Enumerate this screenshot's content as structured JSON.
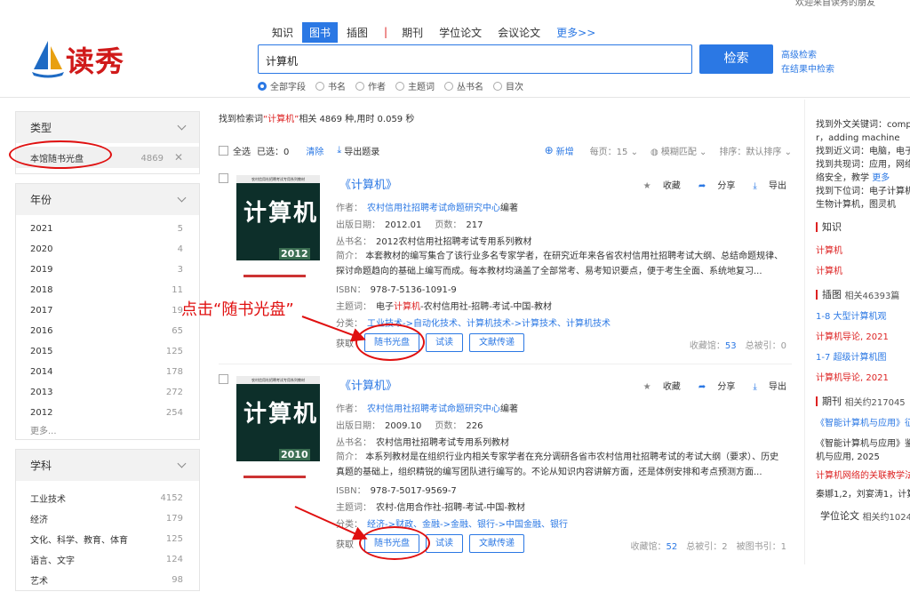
{
  "header": {
    "top_right_text": "欢迎来自读秀的朋友",
    "logo_text": "读秀",
    "tabs": [
      {
        "label": "知识",
        "active": false
      },
      {
        "label": "图书",
        "active": true
      },
      {
        "label": "插图",
        "active": false
      },
      {
        "label": "期刊",
        "active": false
      },
      {
        "label": "学位论文",
        "active": false
      },
      {
        "label": "会议论文",
        "active": false
      }
    ],
    "more_tabs": "更多>>",
    "search_value": "计算机",
    "search_button": "检索",
    "advanced_search": "高级检索",
    "search_in_results": "在结果中检索",
    "field_options": [
      "全部字段",
      "书名",
      "作者",
      "主题词",
      "丛书名",
      "目次"
    ],
    "selected_field": "全部字段"
  },
  "filters": {
    "type": {
      "title": "类型",
      "selected": {
        "label": "本馆随书光盘",
        "count": "4869"
      }
    },
    "year": {
      "title": "年份",
      "items": [
        {
          "label": "2021",
          "count": "5"
        },
        {
          "label": "2020",
          "count": "4"
        },
        {
          "label": "2019",
          "count": "3"
        },
        {
          "label": "2018",
          "count": "11"
        },
        {
          "label": "2017",
          "count": "19"
        },
        {
          "label": "2016",
          "count": "65"
        },
        {
          "label": "2015",
          "count": "125"
        },
        {
          "label": "2014",
          "count": "178"
        },
        {
          "label": "2013",
          "count": "272"
        },
        {
          "label": "2012",
          "count": "254"
        }
      ],
      "more": "更多..."
    },
    "subject": {
      "title": "学科",
      "items": [
        {
          "label": "工业技术",
          "count": "4152"
        },
        {
          "label": "经济",
          "count": "179"
        },
        {
          "label": "文化、科学、教育、体育",
          "count": "125"
        },
        {
          "label": "语言、文字",
          "count": "124"
        },
        {
          "label": "艺术",
          "count": "98"
        }
      ]
    }
  },
  "results_summary": {
    "prefix": "找到检索词",
    "keyword": "“计算机”",
    "suffix": "相关 4869 种,用时 0.059 秒"
  },
  "toolbar": {
    "select_all": "全选",
    "selected": "已选：0",
    "clear": "清除",
    "export": "导出题录",
    "add": "新增",
    "per_page": "每页：15",
    "fuzzy": "模糊匹配",
    "sort": "排序：默认排序"
  },
  "items": [
    {
      "cover_header": "农村信用社招聘考试专用系列教材",
      "cover_title": "计算机",
      "cover_year": "2012",
      "title": "《计算机》",
      "author_label": "作者：",
      "author": "农村信用社招聘考试命题研究中心",
      "author_suffix": "编著",
      "date_label": "出版日期：",
      "date": "2012.01",
      "pages_label": "页数：",
      "pages": "217",
      "series_label": "丛书名：",
      "series": "2012农村信用社招聘考试专用系列教材",
      "abstract_label": "简介：",
      "abstract": "本套教材的编写集合了该行业多名专家学者，在研究近年来各省农村信用社招聘考试大纲、总结命题规律、探讨命题趋向的基础上编写而成。每本教材均涵盖了全部常考、易考知识要点，便于考生全面、系统地复习...",
      "isbn_label": "ISBN：",
      "isbn": "978-7-5136-1091-9",
      "subject_label": "主题词：",
      "subject_pre": "电子",
      "subject_kw": "计算机",
      "subject_post": "-农村信用社-招聘-考试-中国-教材",
      "class_label": "分类：",
      "class": "工业技术->自动化技术、计算机技术->计算技术、计算机技术",
      "actions": [
        "收藏",
        "分享",
        "导出"
      ],
      "get_label": "获取",
      "buttons": [
        "随书光盘",
        "试读",
        "文献传递"
      ],
      "collect_label": "收藏馆：",
      "collect": "53",
      "cited_label": "总被引：",
      "cited": "0",
      "extra_label": "",
      "extra": ""
    },
    {
      "cover_header": "农村信用社招聘考试专用系列教材",
      "cover_title": "计算机",
      "cover_year": "2010",
      "title": "《计算机》",
      "author_label": "作者：",
      "author": "农村信用社招聘考试命题研究中心",
      "author_suffix": "编著",
      "date_label": "出版日期：",
      "date": "2009.10",
      "pages_label": "页数：",
      "pages": "226",
      "series_label": "丛书名：",
      "series": "农村信用社招聘考试专用系列教材",
      "abstract_label": "简介：",
      "abstract": "本系列教材是在组织行业内相关专家学者在充分调研各省市农村信用社招聘考试的考试大纲（要求）、历史真题的基础上，组织精锐的编写团队进行编写的。不论从知识内容讲解方面，还是体例安排和考点预测方面...",
      "isbn_label": "ISBN：",
      "isbn": "978-7-5017-9569-7",
      "subject_label": "主题词：",
      "subject_pre": "",
      "subject_kw": "",
      "subject_post": "农村-信用合作社-招聘-考试-中国-教材",
      "class_label": "分类：",
      "class": "经济->财政、金融->金融、银行->中国金融、银行",
      "actions": [
        "收藏",
        "分享",
        "导出"
      ],
      "get_label": "获取",
      "buttons": [
        "随书光盘",
        "试读",
        "文献传递"
      ],
      "collect_label": "收藏馆：",
      "collect": "52",
      "cited_label": "总被引：",
      "cited": "2",
      "extra_label": "被图书引：",
      "extra": "1"
    }
  ],
  "annotation": "点击“随书光盘”",
  "sidebar": {
    "lines": [
      {
        "text": "找到外文关键词：comp",
        "cls": ""
      },
      {
        "text": "r，adding machine",
        "cls": ""
      },
      {
        "text": "找到近义词：电脑，电子",
        "cls": ""
      },
      {
        "text": "找到共现词：应用，网络",
        "cls": ""
      },
      {
        "text": "络安全，教学",
        "cls": ""
      },
      {
        "text": "找到下位词：电子计算机",
        "cls": ""
      },
      {
        "text": "生物计算机，图灵机",
        "cls": ""
      }
    ],
    "more": "更多",
    "knowledge_title": "知识",
    "knowledge_items": [
      "计算机",
      "计算机"
    ],
    "figures_title": "插图",
    "figures_count": "相关46393篇",
    "figure_items": [
      "1-8 大型计算机观",
      "计算机导论, 2021",
      "1-7 超级计算机图",
      "计算机导论, 2021"
    ],
    "journals_title": "期刊",
    "journals_count": "相关约217045",
    "journal_items": [
      "《智能计算机与应用》征",
      "《智能计算机与应用》鉴",
      "机与应用, 2025",
      "计算机网络的关联教学法",
      "秦娜1,2，刘宴涛1，计算"
    ],
    "thesis_title": "学位论文",
    "thesis_count": "相关约1024"
  }
}
